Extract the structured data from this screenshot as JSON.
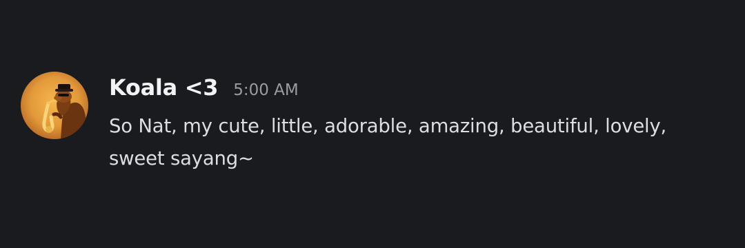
{
  "message": {
    "author": "Koala <3",
    "timestamp": "5:00 AM",
    "text": "So Nat, my cute, little, adorable, amazing, beautiful, lovely, sweet sayang~",
    "avatar_icon": "saxophone-camel-avatar"
  },
  "colors": {
    "background": "#1a1b1e",
    "username": "#f2f3f5",
    "timestamp": "#9a9ca3",
    "message_text": "#dcdee1",
    "avatar_accent": "#e39a3a"
  }
}
